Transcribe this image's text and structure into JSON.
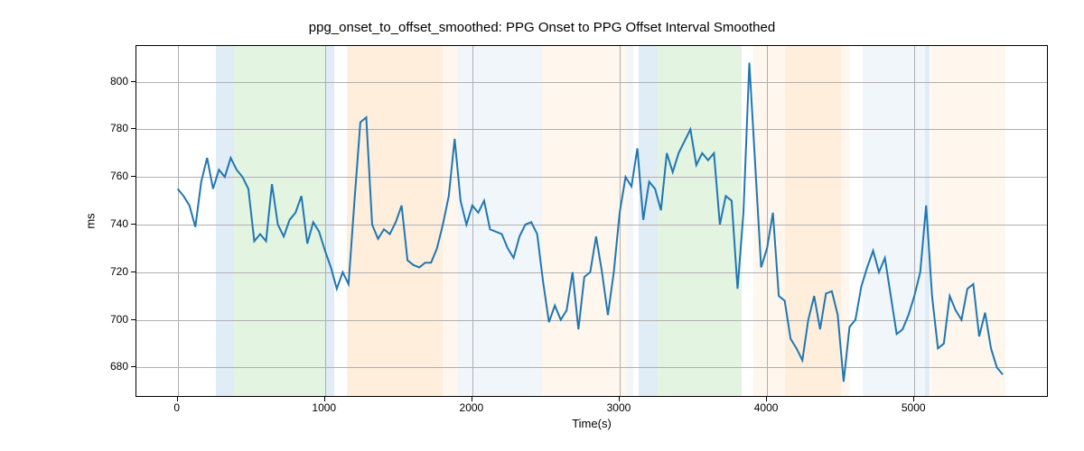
{
  "chart_data": {
    "type": "line",
    "title": "ppg_onset_to_offset_smoothed: PPG Onset to PPG Offset Interval Smoothed",
    "xlabel": "Time(s)",
    "ylabel": "ms",
    "xlim": [
      -280,
      5900
    ],
    "ylim": [
      668,
      815
    ],
    "xticks": [
      0,
      1000,
      2000,
      3000,
      4000,
      5000
    ],
    "yticks": [
      680,
      700,
      720,
      740,
      760,
      780,
      800
    ],
    "bands": [
      {
        "x0": 260,
        "x1": 380,
        "color": "blue"
      },
      {
        "x0": 380,
        "x1": 1000,
        "color": "green"
      },
      {
        "x0": 1000,
        "x1": 1060,
        "color": "blue"
      },
      {
        "x0": 1150,
        "x1": 1800,
        "color": "orange"
      },
      {
        "x0": 1800,
        "x1": 1900,
        "color": "lightorange"
      },
      {
        "x0": 1900,
        "x1": 2470,
        "color": "lightblue"
      },
      {
        "x0": 2470,
        "x1": 3050,
        "color": "lightorange"
      },
      {
        "x0": 3050,
        "x1": 3090,
        "color": "lightblue"
      },
      {
        "x0": 3130,
        "x1": 3260,
        "color": "blue"
      },
      {
        "x0": 3260,
        "x1": 3830,
        "color": "green"
      },
      {
        "x0": 3910,
        "x1": 4120,
        "color": "lightorange"
      },
      {
        "x0": 4120,
        "x1": 4500,
        "color": "orange"
      },
      {
        "x0": 4500,
        "x1": 4560,
        "color": "lightorange"
      },
      {
        "x0": 4650,
        "x1": 5070,
        "color": "lightblue"
      },
      {
        "x0": 5070,
        "x1": 5100,
        "color": "blue"
      },
      {
        "x0": 5110,
        "x1": 5620,
        "color": "lightorange"
      }
    ],
    "x": [
      0,
      40,
      80,
      120,
      160,
      200,
      240,
      280,
      320,
      360,
      400,
      440,
      480,
      520,
      560,
      600,
      640,
      680,
      720,
      760,
      800,
      840,
      880,
      920,
      960,
      1000,
      1040,
      1080,
      1120,
      1160,
      1200,
      1240,
      1280,
      1320,
      1360,
      1400,
      1440,
      1480,
      1520,
      1560,
      1600,
      1640,
      1680,
      1720,
      1760,
      1800,
      1840,
      1880,
      1920,
      1960,
      2000,
      2040,
      2080,
      2120,
      2160,
      2200,
      2240,
      2280,
      2320,
      2360,
      2400,
      2440,
      2480,
      2520,
      2560,
      2600,
      2640,
      2680,
      2720,
      2760,
      2800,
      2840,
      2880,
      2920,
      2960,
      3000,
      3040,
      3080,
      3120,
      3160,
      3200,
      3240,
      3280,
      3320,
      3360,
      3400,
      3440,
      3480,
      3520,
      3560,
      3600,
      3640,
      3680,
      3720,
      3760,
      3800,
      3840,
      3880,
      3920,
      3960,
      4000,
      4040,
      4080,
      4120,
      4160,
      4200,
      4240,
      4280,
      4320,
      4360,
      4400,
      4440,
      4480,
      4520,
      4560,
      4600,
      4640,
      4680,
      4720,
      4760,
      4800,
      4840,
      4880,
      4920,
      4960,
      5000,
      5040,
      5080,
      5120,
      5160,
      5200,
      5240,
      5280,
      5320,
      5360,
      5400,
      5440,
      5480,
      5520,
      5560,
      5600
    ],
    "values": [
      755,
      752,
      748,
      739,
      758,
      768,
      755,
      763,
      760,
      768,
      763,
      760,
      755,
      733,
      736,
      733,
      757,
      740,
      735,
      742,
      745,
      752,
      732,
      741,
      737,
      729,
      722,
      713,
      720,
      715,
      750,
      783,
      785,
      740,
      734,
      738,
      736,
      741,
      748,
      725,
      723,
      722,
      724,
      724,
      730,
      740,
      752,
      776,
      750,
      740,
      748,
      745,
      750,
      738,
      737,
      736,
      730,
      726,
      735,
      740,
      741,
      736,
      716,
      699,
      706,
      700,
      704,
      720,
      696,
      718,
      720,
      735,
      720,
      702,
      720,
      745,
      760,
      756,
      772,
      742,
      758,
      755,
      746,
      770,
      762,
      770,
      775,
      780,
      765,
      770,
      767,
      770,
      740,
      752,
      750,
      713,
      745,
      808,
      765,
      722,
      730,
      745,
      710,
      708,
      692,
      688,
      683,
      700,
      710,
      696,
      711,
      712,
      702,
      674,
      697,
      700,
      714,
      722,
      729,
      720,
      726,
      710,
      694,
      696,
      702,
      710,
      720,
      748,
      710,
      688,
      690,
      710,
      704,
      700,
      713,
      715,
      693,
      703,
      688,
      680,
      677
    ]
  }
}
